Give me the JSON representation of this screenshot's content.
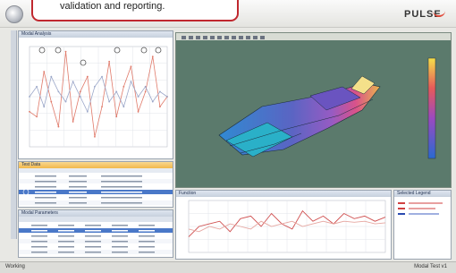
{
  "app": {
    "brand": "PULSE",
    "callout_text": "validation and reporting."
  },
  "panes": {
    "top_left_title": "Modal Analysis",
    "table_title": "Test Data",
    "table2_title": "Modal Parameters",
    "bottom_chart_title": "Function",
    "legend_title": "Selected Legend"
  },
  "status": {
    "left": "Working",
    "right": "Modal Test v1"
  },
  "colors": {
    "accent": "#f2b84b",
    "selection": "#4a78c8",
    "model_surface": "#7a60c0",
    "background_3d": "#5b7a6c",
    "callout_border": "#c0282f"
  },
  "icons": [
    "app-logo-icon",
    "toolbar-icon",
    "colorbar-icon"
  ],
  "chart_data": [
    {
      "type": "line",
      "series": [
        {
          "values": [
            0.35,
            0.3,
            0.75,
            0.45,
            0.2,
            0.95,
            0.25,
            0.55,
            0.7,
            0.1,
            0.4,
            0.85,
            0.3,
            0.6,
            0.8,
            0.35,
            0.55,
            0.9,
            0.4,
            0.5
          ]
        },
        {
          "values": [
            0.5,
            0.6,
            0.4,
            0.7,
            0.55,
            0.45,
            0.65,
            0.5,
            0.35,
            0.6,
            0.7,
            0.45,
            0.55,
            0.4,
            0.65,
            0.5,
            0.6,
            0.45,
            0.55,
            0.5
          ]
        }
      ]
    },
    {
      "type": "line",
      "series": [
        {
          "values": [
            0.3,
            0.5,
            0.55,
            0.6,
            0.4,
            0.65,
            0.7,
            0.5,
            0.75,
            0.55,
            0.45,
            0.8,
            0.6,
            0.7,
            0.55,
            0.75,
            0.65,
            0.7,
            0.6,
            0.68
          ]
        },
        {
          "values": [
            0.45,
            0.4,
            0.5,
            0.45,
            0.55,
            0.5,
            0.45,
            0.6,
            0.5,
            0.55,
            0.6,
            0.5,
            0.55,
            0.6,
            0.55,
            0.6,
            0.58,
            0.6,
            0.55,
            0.57
          ]
        }
      ]
    }
  ]
}
